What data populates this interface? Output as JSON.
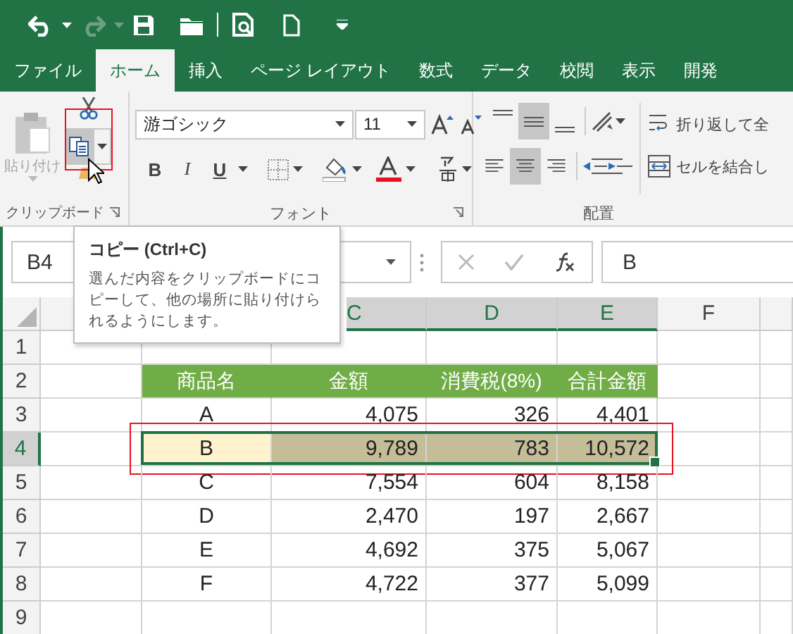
{
  "quick_access": {
    "redo_disabled": true
  },
  "tabs": [
    {
      "label": "ファイル",
      "selected": false
    },
    {
      "label": "ホーム",
      "selected": true
    },
    {
      "label": "挿入",
      "selected": false
    },
    {
      "label": "ページ レイアウト",
      "selected": false
    },
    {
      "label": "数式",
      "selected": false
    },
    {
      "label": "データ",
      "selected": false
    },
    {
      "label": "校閲",
      "selected": false
    },
    {
      "label": "表示",
      "selected": false
    },
    {
      "label": "開発",
      "selected": false
    }
  ],
  "ribbon": {
    "clipboard": {
      "label": "クリップボード",
      "paste_label": "貼り付け",
      "paste_disabled": true,
      "copy_hovered": true
    },
    "font": {
      "label": "フォント",
      "font_name": "游ゴシック",
      "font_size": "11",
      "bold": "B",
      "italic": "I",
      "underline": "U"
    },
    "alignment": {
      "label": "配置",
      "vertical": [
        {
          "selected": false
        },
        {
          "selected": true
        },
        {
          "selected": false
        }
      ],
      "horizontal": [
        {
          "selected": false
        },
        {
          "selected": true
        },
        {
          "selected": false
        }
      ],
      "wrap_text": "折り返して全",
      "merge": "セルを結合し"
    }
  },
  "tooltip": {
    "title": "コピー (Ctrl+C)",
    "text": "選んだ内容をクリップボードにコピーして、他の場所に貼り付けられるようにします。"
  },
  "formula_bar": {
    "name_box": "B4",
    "formula": "B"
  },
  "sheet": {
    "columns": [
      {
        "label": "C",
        "selected": true
      },
      {
        "label": "D",
        "selected": true
      },
      {
        "label": "E",
        "selected": true
      },
      {
        "label": "F",
        "selected": false
      }
    ],
    "row_numbers": [
      {
        "label": "1",
        "selected": false
      },
      {
        "label": "2",
        "selected": false
      },
      {
        "label": "3",
        "selected": false
      },
      {
        "label": "4",
        "selected": true
      },
      {
        "label": "5",
        "selected": false
      },
      {
        "label": "6",
        "selected": false
      },
      {
        "label": "7",
        "selected": false
      },
      {
        "label": "8",
        "selected": false
      },
      {
        "label": "9",
        "selected": false
      }
    ],
    "table": {
      "header": [
        "商品名",
        "金額",
        "消費税(8%)",
        "合計金額"
      ],
      "rows": [
        {
          "cells": [
            "A",
            "4,075",
            "326",
            "4,401"
          ],
          "selected": false
        },
        {
          "cells": [
            "B",
            "9,789",
            "783",
            "10,572"
          ],
          "selected": true
        },
        {
          "cells": [
            "C",
            "7,554",
            "604",
            "8,158"
          ],
          "selected": false
        },
        {
          "cells": [
            "D",
            "2,470",
            "197",
            "2,667"
          ],
          "selected": false
        },
        {
          "cells": [
            "E",
            "4,692",
            "375",
            "5,067"
          ],
          "selected": false
        },
        {
          "cells": [
            "F",
            "4,722",
            "377",
            "5,099"
          ],
          "selected": false
        }
      ]
    }
  },
  "highlights": {
    "copy_button": true,
    "selected_row": true
  }
}
